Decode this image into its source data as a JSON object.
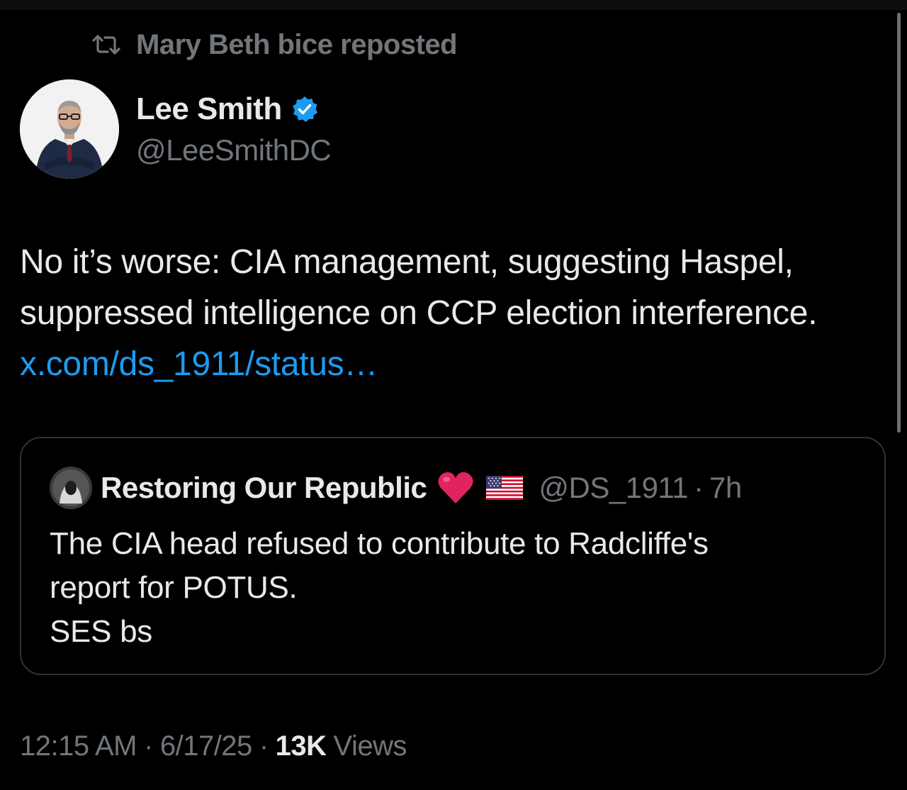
{
  "repost": {
    "text": "Mary Beth bice reposted",
    "icon": "repost-icon"
  },
  "author": {
    "name": "Lee Smith",
    "handle": "@LeeSmithDC",
    "verified": true,
    "verified_color": "#1d9bf0"
  },
  "tweet": {
    "text": "No it’s worse: CIA management, suggesting Haspel, suppressed intelligence on CCP election interference.",
    "link_text": "x.com/ds_1911/status…",
    "link_color": "#1d9bf0"
  },
  "quote": {
    "name": "Restoring Our Republic",
    "emoji_heart": "heart-icon",
    "emoji_flag": "us-flag-icon",
    "handle": "@DS_1911",
    "separator": "·",
    "time": "7h",
    "lines": [
      "The CIA head refused to contribute to Radcliffe's",
      "report for POTUS.",
      "SES bs"
    ]
  },
  "meta": {
    "time": "12:15 AM",
    "date": "6/17/25",
    "separator": "·",
    "views_count": "13K",
    "views_label": "Views"
  },
  "colors": {
    "background": "#000000",
    "text_primary": "#e7e9ea",
    "text_secondary": "#71767b",
    "border": "#2f3336",
    "accent": "#1d9bf0"
  }
}
